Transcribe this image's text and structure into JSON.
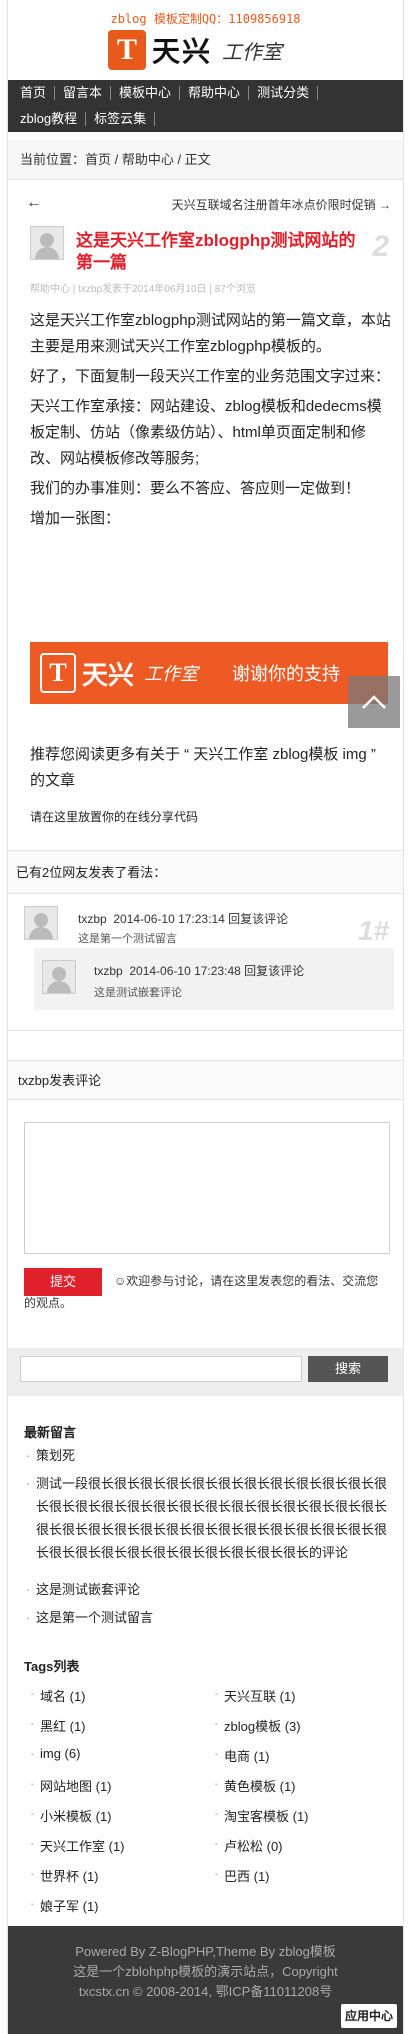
{
  "header": {
    "ad_text": "zblog 模板定制QQ：1109856918",
    "logo_mark": "T",
    "logo_text": "天兴",
    "logo_script": "工作室"
  },
  "nav": {
    "row1": [
      "首页",
      "留言本",
      "模板中心",
      "帮助中心",
      "测试分类"
    ],
    "row2": [
      "zblog教程",
      "标签云集"
    ]
  },
  "breadcrumb": "当前位置：首页 / 帮助中心 / 正文",
  "article": {
    "prev_arrow": "←",
    "next_link": "天兴互联域名注册首年冰点价限时促销 →",
    "title": "这是天兴工作室zblogphp测试网站的第一篇",
    "number": "2",
    "meta": "帮助中心 | txzbp发表于2014年06月10日 | 87个浏览",
    "paragraphs": [
      "这是天兴工作室zblogphp测试网站的第一篇文章，本站主要是用来测试天兴工作室zblogphp模板的。",
      "好了，下面复制一段天兴工作室的业务范围文字过来：",
      "天兴工作室承接：网站建设、zblog模板和dedecms模板定制、仿站（像素级仿站）、html单页面定制和修改、网站模板修改等服务;",
      "我们的办事准则：要么不答应、答应则一定做到！",
      "增加一张图："
    ],
    "banner_mark": "T",
    "banner_text": "天兴",
    "banner_script": "工作室",
    "banner_thanks": "谢谢你的支持",
    "related": "推荐您阅读更多有关于 “ 天兴工作室 zblog模板 img ” 的文章",
    "share": "请在这里放置你的在线分享代码"
  },
  "comments": {
    "count_text": "已有2位网友发表了看法：",
    "floor": "1#",
    "items": [
      {
        "name": "txzbp",
        "time": "2014-06-10 17:23:14",
        "reply": "回复该评论",
        "text": "这是第一个测试留言"
      },
      {
        "name": "txzbp",
        "time": "2014-06-10 17:23:48",
        "reply": "回复该评论",
        "text": "这是测试嵌套评论"
      }
    ]
  },
  "form": {
    "header": "txzbp发表评论",
    "submit": "提交",
    "note": "☺欢迎参与讨论，请在这里发表您的看法、交流您的观点。"
  },
  "search": {
    "button": "搜索"
  },
  "recent": {
    "title": "最新留言",
    "items": [
      "策划死",
      "测试一段很长很长很长很长很长很长很长很长很长很长很长很长很长很长很长很长很长很长很长很长很长很长很长很长很长很长很长很长很长很长很长很长很长很长很长很长很长很长很长很长很长很长很长很长很长很长很长很长很长的评论",
      "这是测试嵌套评论",
      "这是第一个测试留言"
    ]
  },
  "tags": {
    "title": "Tags列表",
    "items": [
      "域名 (1)",
      "天兴互联 (1)",
      "黑红 (1)",
      "zblog模板 (3)",
      "img (6)",
      "电商 (1)",
      "网站地图 (1)",
      "黄色模板 (1)",
      "小米模板 (1)",
      "淘宝客模板 (1)",
      "天兴工作室 (1)",
      "卢松松 (0)",
      "世界杯 (1)",
      "巴西 (1)",
      "娘子军 (1)"
    ]
  },
  "footer": {
    "line1": "Powered By Z-BlogPHP,Theme By zblog模板",
    "line2": "这是一个zblohphp模板的演示站点，Copyright",
    "line3": "txcstx.cn © 2008-2014, 鄂ICP备11011208号",
    "app_badge": "应用中心"
  }
}
